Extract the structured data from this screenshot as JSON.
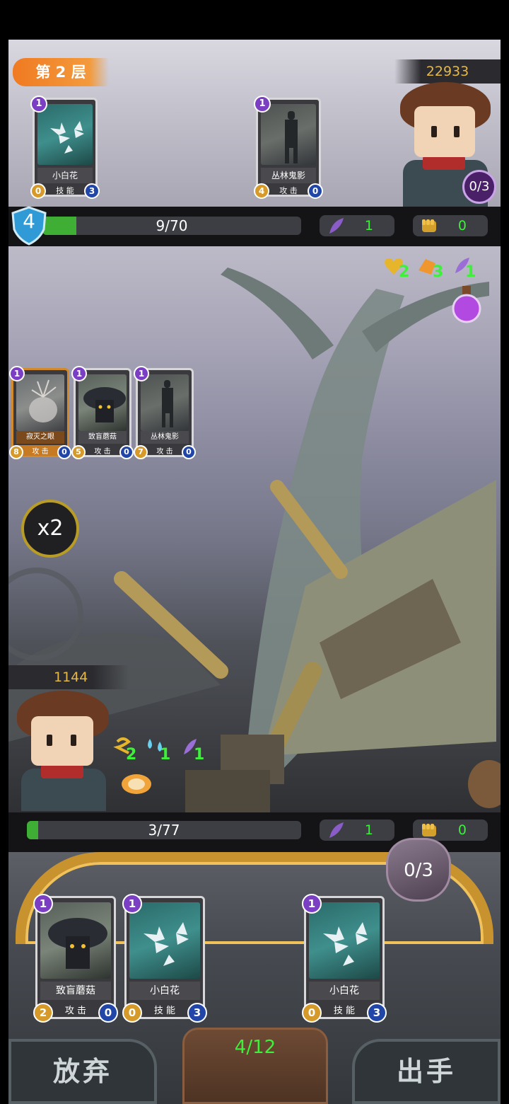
{
  "enemy": {
    "floor_label": "第 2 层",
    "score": "22933",
    "hand_badge": "0/3",
    "cards": [
      {
        "level": "1",
        "name": "小白花",
        "type": "技 能",
        "cost": "0",
        "value": "3"
      },
      {
        "level": "1",
        "name": "丛林鬼影",
        "type": "攻 击",
        "cost": "4",
        "value": "0"
      }
    ],
    "shield": "4",
    "hp_text": "9/70",
    "hp_fraction": 0.13,
    "feather": "1",
    "fist": "0",
    "drops": [
      "2",
      "3",
      "1"
    ],
    "field_cards": [
      {
        "level": "1",
        "name": "寂灭之眼",
        "type": "攻 击",
        "cost": "8",
        "value": "0"
      },
      {
        "level": "1",
        "name": "致盲蘑菇",
        "type": "攻 击",
        "cost": "5",
        "value": "0"
      },
      {
        "level": "1",
        "name": "丛林鬼影",
        "type": "攻 击",
        "cost": "7",
        "value": "0"
      }
    ]
  },
  "multiplier": "x2",
  "player": {
    "score": "1144",
    "buffs": [
      "2",
      "1",
      "1"
    ],
    "hp_text": "3/77",
    "hp_fraction": 0.04,
    "feather": "1",
    "fist": "0",
    "mana": "0/3",
    "hand": [
      {
        "level": "1",
        "name": "致盲蘑菇",
        "type": "攻 击",
        "cost": "2",
        "value": "0"
      },
      {
        "level": "1",
        "name": "小白花",
        "type": "技 能",
        "cost": "0",
        "value": "3"
      },
      {
        "level": "1",
        "name": "小白花",
        "type": "技 能",
        "cost": "0",
        "value": "3"
      }
    ],
    "deck": "4/12",
    "discard_label": "放弃",
    "play_label": "出手"
  },
  "colors": {
    "accent_orange": "#f07a22",
    "hp_green": "#3fae35",
    "level_purple": "#7b3fc4",
    "value_blue": "#2146a8",
    "gold": "#c8932e"
  }
}
